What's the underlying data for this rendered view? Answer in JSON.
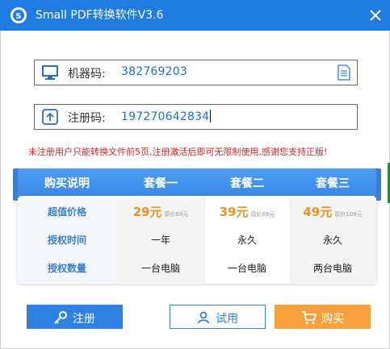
{
  "window": {
    "title": "Small PDF转换软件V3.6"
  },
  "machine_code": {
    "label": "机器码:",
    "value": "382769203"
  },
  "register_code": {
    "label": "注册码:",
    "value": "197270642834"
  },
  "notice": "未注册用户只能转换文件前5页,注册激活后即可无限制使用,感谢您支持正版!",
  "plans": {
    "header_label": "购买说明",
    "columns": [
      "套餐一",
      "套餐二",
      "套餐三"
    ],
    "rows": [
      {
        "label": "超值价格",
        "cells": [
          {
            "price": "29元",
            "original": "原价69元"
          },
          {
            "price": "39元",
            "original": "原价89元"
          },
          {
            "price": "49元",
            "original": "原价109元"
          }
        ]
      },
      {
        "label": "授权时间",
        "cells": [
          "一年",
          "永久",
          "永久"
        ]
      },
      {
        "label": "授权数量",
        "cells": [
          "一台电脑",
          "一台电脑",
          "两台电脑"
        ]
      }
    ]
  },
  "buttons": {
    "register": "注册",
    "trial": "试用",
    "buy": "购买"
  },
  "colors": {
    "titlebar": "#1f7ce0",
    "accent_blue": "#2f82e4",
    "notice_red": "#e02020",
    "price_orange": "#f0901e",
    "buy_orange": "#f7a13c"
  },
  "icons": {
    "app": "app-logo-icon",
    "close": "close-icon",
    "machine": "monitor-icon",
    "register": "upload-arrow-icon",
    "document": "document-icon",
    "key": "key-icon",
    "user": "user-icon",
    "cart": "cart-icon"
  }
}
